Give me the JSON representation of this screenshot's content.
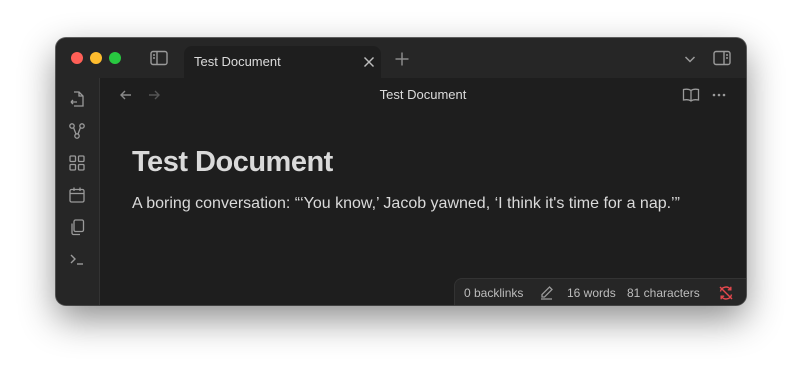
{
  "window": {
    "tab_title": "Test Document",
    "view_title": "Test Document",
    "traffic_colors": {
      "close": "#ff5f57",
      "minimize": "#febc2e",
      "maximize": "#28c840"
    }
  },
  "ribbon": {
    "icons": [
      "open-quick-switcher-icon",
      "graph-view-icon",
      "canvas-icon",
      "daily-note-icon",
      "templates-icon",
      "command-palette-icon"
    ]
  },
  "document": {
    "heading": "Test Document",
    "paragraph": "A boring conversation: “‘You know,’ Jacob yawned, ‘I think it's time for a nap.’”"
  },
  "status_bar": {
    "backlinks": "0 backlinks",
    "words": "16 words",
    "characters": "81 characters",
    "sync_color": "#e5484d"
  }
}
